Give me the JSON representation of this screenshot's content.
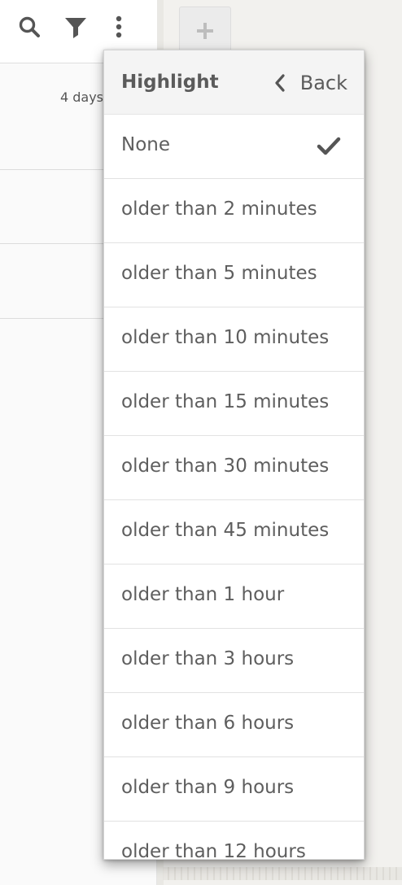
{
  "toolbar": {
    "icons": [
      "search-icon",
      "filter-icon",
      "more-vertical-icon"
    ]
  },
  "column": {
    "rows": [
      {
        "time": "4 days"
      },
      {
        "time": ""
      },
      {
        "time": ""
      }
    ],
    "add_icon": "plus-icon"
  },
  "menu": {
    "title": "Highlight",
    "back_label": "Back",
    "selected": "None",
    "items": [
      {
        "label": "None",
        "selected": true
      },
      {
        "label": "older than 2 minutes",
        "selected": false
      },
      {
        "label": "older than 5 minutes",
        "selected": false
      },
      {
        "label": "older than 10 minutes",
        "selected": false
      },
      {
        "label": "older than 15 minutes",
        "selected": false
      },
      {
        "label": "older than 30 minutes",
        "selected": false
      },
      {
        "label": "older than 45 minutes",
        "selected": false
      },
      {
        "label": "older than 1 hour",
        "selected": false
      },
      {
        "label": "older than 3 hours",
        "selected": false
      },
      {
        "label": "older than 6 hours",
        "selected": false
      },
      {
        "label": "older than 9 hours",
        "selected": false
      },
      {
        "label": "older than 12 hours",
        "selected": false
      }
    ]
  },
  "colors": {
    "icon": "#555555",
    "text": "#5e5e5e",
    "menu_header_bg": "#f4f4f4",
    "background": "#f2f1ee"
  }
}
